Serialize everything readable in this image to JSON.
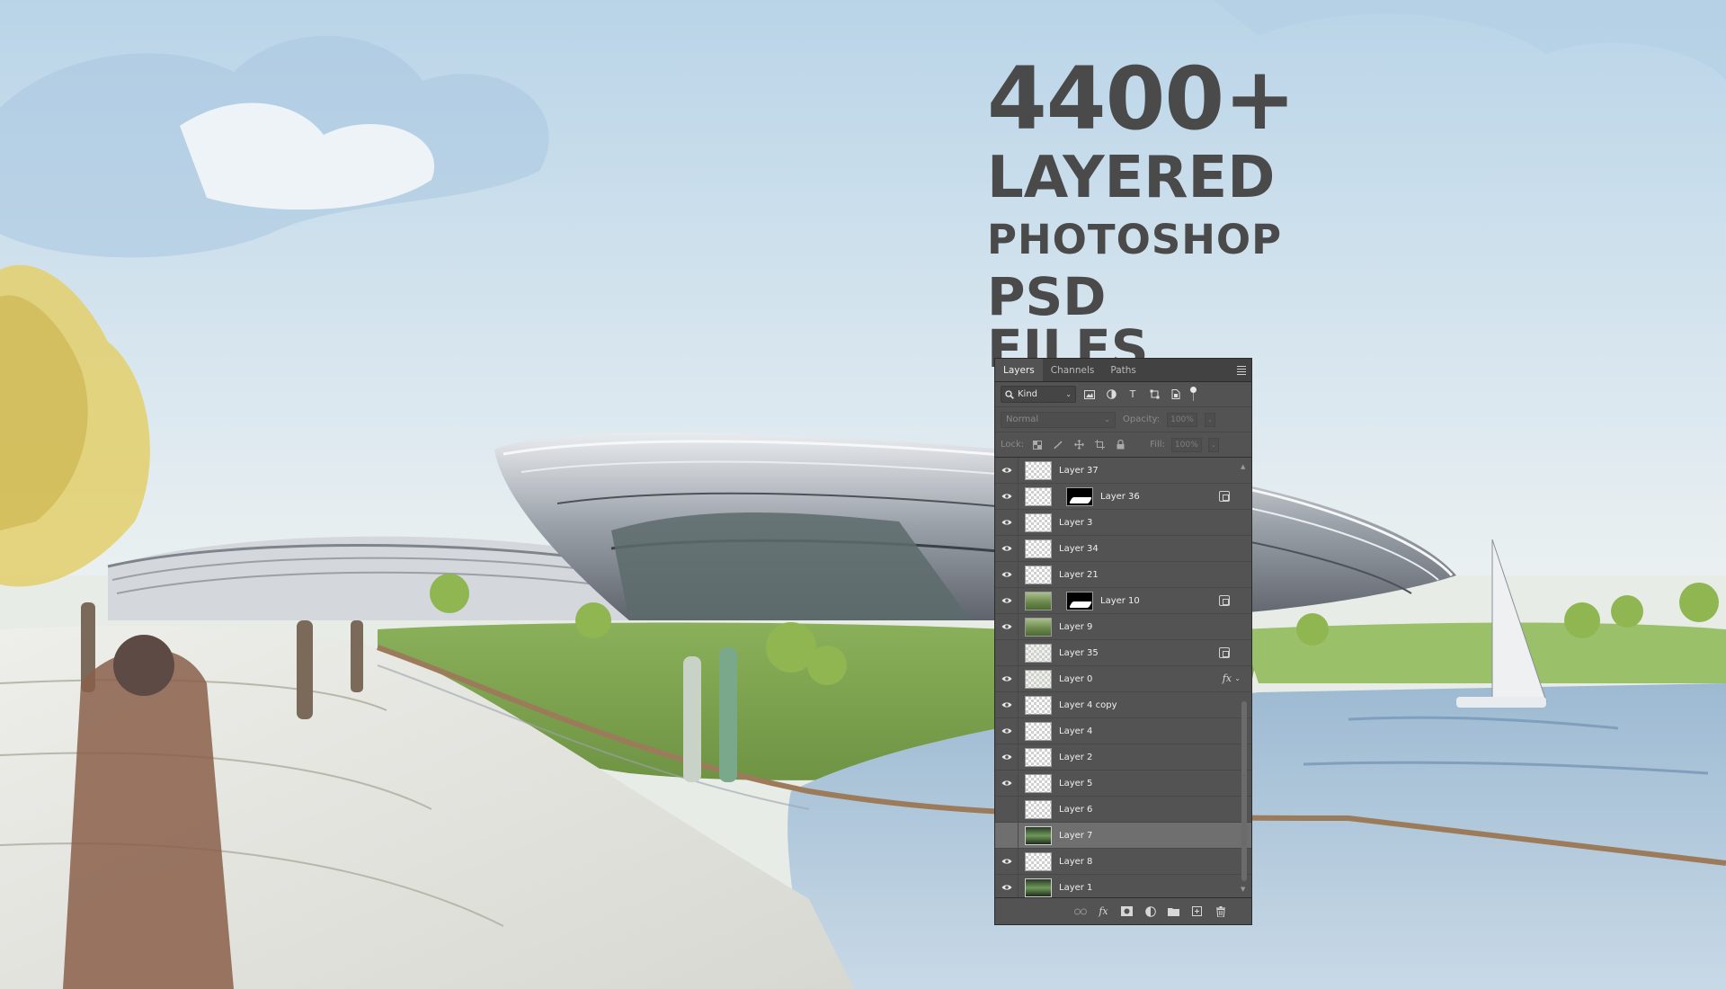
{
  "headline": {
    "count": "4400+",
    "line2": "LAYERED",
    "line3": "PHOTOSHOP",
    "line4": "PSD FILES"
  },
  "panel": {
    "tabs": [
      {
        "label": "Layers",
        "active": true
      },
      {
        "label": "Channels",
        "active": false
      },
      {
        "label": "Paths",
        "active": false
      }
    ],
    "filter": {
      "kind_label": "Kind"
    },
    "blend": {
      "mode": "Normal",
      "opacity_label": "Opacity:",
      "opacity_value": "100%"
    },
    "lock": {
      "label": "Lock:",
      "fill_label": "Fill:",
      "fill_value": "100%"
    },
    "layers": [
      {
        "name": "Layer 37",
        "visible": true
      },
      {
        "name": "Layer 36",
        "visible": true,
        "mask": true,
        "badge": "link"
      },
      {
        "name": "Layer 3",
        "visible": true
      },
      {
        "name": "Layer 34",
        "visible": true
      },
      {
        "name": "Layer 21",
        "visible": true
      },
      {
        "name": "Layer 10",
        "visible": true,
        "mask": true,
        "badge": "link"
      },
      {
        "name": "Layer 9",
        "visible": true
      },
      {
        "name": "Layer 35",
        "visible": false,
        "badge": "link"
      },
      {
        "name": "Layer 0",
        "visible": true,
        "badge": "fx"
      },
      {
        "name": "Layer 4 copy",
        "visible": true
      },
      {
        "name": "Layer 4",
        "visible": true
      },
      {
        "name": "Layer 2",
        "visible": true
      },
      {
        "name": "Layer 5",
        "visible": true
      },
      {
        "name": "Layer 6",
        "visible": false
      },
      {
        "name": "Layer 7",
        "visible": false,
        "selected": true
      },
      {
        "name": "Layer 8",
        "visible": true
      },
      {
        "name": "Layer 1",
        "visible": true
      }
    ],
    "fx_symbol": "fx"
  },
  "colors": {
    "panel_bg": "#535353",
    "headline_text": "#4a4a4a",
    "sky": "#cfe3ee"
  }
}
